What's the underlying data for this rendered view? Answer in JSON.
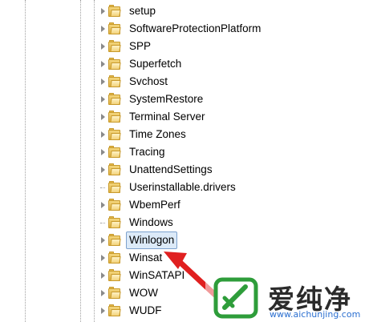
{
  "tree": {
    "items": [
      {
        "label": "setup",
        "expandable": true,
        "selected": false
      },
      {
        "label": "SoftwareProtectionPlatform",
        "expandable": true,
        "selected": false
      },
      {
        "label": "SPP",
        "expandable": true,
        "selected": false
      },
      {
        "label": "Superfetch",
        "expandable": true,
        "selected": false
      },
      {
        "label": "Svchost",
        "expandable": true,
        "selected": false
      },
      {
        "label": "SystemRestore",
        "expandable": true,
        "selected": false
      },
      {
        "label": "Terminal Server",
        "expandable": true,
        "selected": false
      },
      {
        "label": "Time Zones",
        "expandable": true,
        "selected": false
      },
      {
        "label": "Tracing",
        "expandable": true,
        "selected": false
      },
      {
        "label": "UnattendSettings",
        "expandable": true,
        "selected": false
      },
      {
        "label": "Userinstallable.drivers",
        "expandable": false,
        "selected": false
      },
      {
        "label": "WbemPerf",
        "expandable": true,
        "selected": false
      },
      {
        "label": "Windows",
        "expandable": false,
        "selected": false
      },
      {
        "label": "Winlogon",
        "expandable": true,
        "selected": true
      },
      {
        "label": "Winsat",
        "expandable": true,
        "selected": false
      },
      {
        "label": "WinSATAPI",
        "expandable": true,
        "selected": false
      },
      {
        "label": "WOW",
        "expandable": true,
        "selected": false
      },
      {
        "label": "WUDF",
        "expandable": true,
        "selected": false
      }
    ]
  },
  "watermark": {
    "title": "爱纯净",
    "url": "www.aichunjing.com",
    "accent_color": "#2e9d3a"
  },
  "annotation": {
    "arrow_color": "#e02020"
  }
}
